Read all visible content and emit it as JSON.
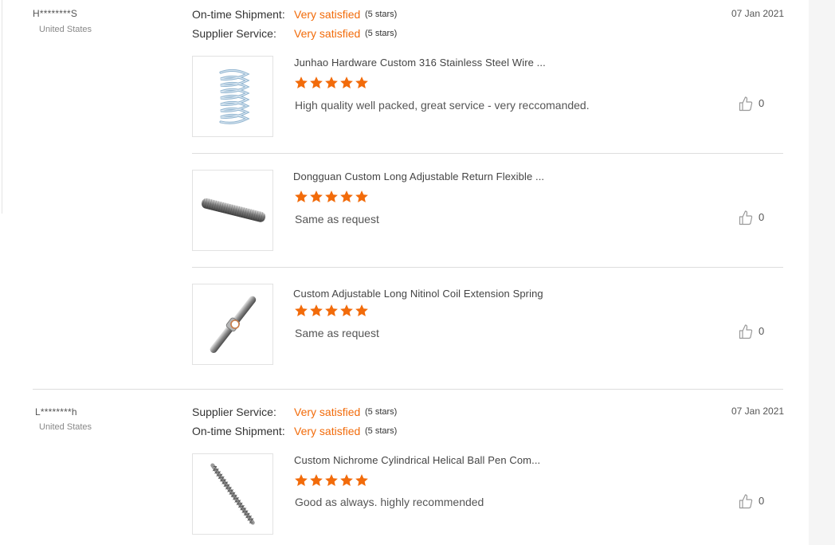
{
  "colors": {
    "accent": "#f26b0a",
    "star": "#f26b0a",
    "separator": "#dcdcdc"
  },
  "reviews": [
    {
      "buyer": "H********S",
      "country": "United States",
      "date": "07 Jan 2021",
      "ratings": [
        {
          "label": "On-time Shipment:",
          "value": "Very satisfied",
          "stars": "(5 stars)"
        },
        {
          "label": "Supplier Service:",
          "value": "Very satisfied",
          "stars": "(5 stars)"
        }
      ],
      "products": [
        {
          "title": "Junhao Hardware Custom 316 Stainless Steel Wire  ...",
          "stars": 5,
          "comment": "High quality well packed, great service - very reccomanded.",
          "likes": "0",
          "thumb_icon": "compression-spring"
        },
        {
          "title": "Dongguan Custom Long Adjustable Return Flexible ...",
          "stars": 5,
          "comment": "Same as request",
          "likes": "0",
          "thumb_icon": "extension-spring"
        },
        {
          "title": "Custom Adjustable Long Nitinol Coil Extension Spring",
          "stars": 5,
          "comment": "Same as request",
          "likes": "0",
          "thumb_icon": "nitinol-spring"
        }
      ]
    },
    {
      "buyer": "L********h",
      "country": "United States",
      "date": "07 Jan 2021",
      "ratings": [
        {
          "label": "Supplier Service:",
          "value": "Very satisfied",
          "stars": "(5 stars)"
        },
        {
          "label": "On-time Shipment:",
          "value": "Very satisfied",
          "stars": "(5 stars)"
        }
      ],
      "products": [
        {
          "title": "Custom Nichrome Cylindrical Helical Ball Pen Com...",
          "stars": 5,
          "comment": "Good as always. highly recommended",
          "likes": "0",
          "thumb_icon": "pen-spring"
        }
      ]
    }
  ]
}
